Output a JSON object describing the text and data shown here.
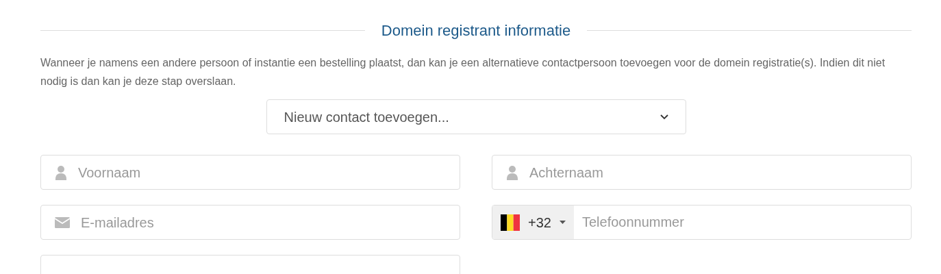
{
  "section": {
    "title": "Domein registrant informatie"
  },
  "description": "Wanneer je namens een andere persoon of instantie een bestelling plaatst, dan kan je een alternatieve contactpersoon toevoegen voor de domein registratie(s). Indien dit niet nodig is dan kan je deze stap overslaan.",
  "contact_select": {
    "value": "Nieuw contact toevoegen..."
  },
  "fields": [
    {
      "kind": "person",
      "placeholder": "Voornaam"
    },
    {
      "kind": "person",
      "placeholder": "Achternaam"
    },
    {
      "kind": "email",
      "placeholder": "E-mailadres"
    },
    {
      "kind": "phone",
      "country_code": "+32",
      "placeholder": "Telefoonnummer"
    },
    {
      "kind": "blank"
    }
  ]
}
